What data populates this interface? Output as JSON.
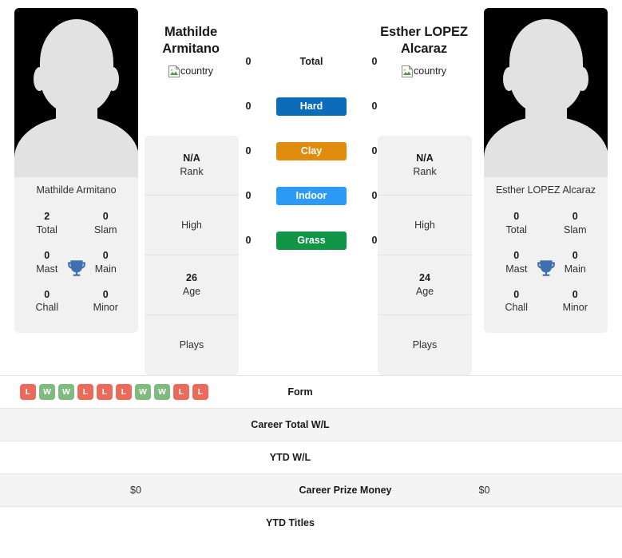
{
  "players": [
    {
      "full_name_line1": "Mathilde",
      "full_name_line2": "Armitano",
      "card_name": "Mathilde Armitano",
      "flag_alt": "country",
      "titles": {
        "total": "2",
        "total_label": "Total",
        "slam": "0",
        "slam_label": "Slam",
        "mast": "0",
        "mast_label": "Mast",
        "main": "0",
        "main_label": "Main",
        "chall": "0",
        "chall_label": "Chall",
        "minor": "0",
        "minor_label": "Minor"
      },
      "info": [
        {
          "value": "N/A",
          "label": "Rank"
        },
        {
          "value": "",
          "label": "High"
        },
        {
          "value": "26",
          "label": "Age"
        },
        {
          "value": "",
          "label": "Plays"
        }
      ],
      "surface_scores": {
        "total": "0",
        "hard": "0",
        "clay": "0",
        "indoor": "0",
        "grass": "0"
      },
      "form": [
        "L",
        "W",
        "W",
        "L",
        "L",
        "L",
        "W",
        "W",
        "L",
        "L"
      ],
      "career_total_wl": "",
      "ytd_wl": "",
      "career_prize_money": "$0",
      "ytd_titles": ""
    },
    {
      "full_name_line1": "Esther LOPEZ",
      "full_name_line2": "Alcaraz",
      "card_name": "Esther LOPEZ Alcaraz",
      "flag_alt": "country",
      "titles": {
        "total": "0",
        "total_label": "Total",
        "slam": "0",
        "slam_label": "Slam",
        "mast": "0",
        "mast_label": "Mast",
        "main": "0",
        "main_label": "Main",
        "chall": "0",
        "chall_label": "Chall",
        "minor": "0",
        "minor_label": "Minor"
      },
      "info": [
        {
          "value": "N/A",
          "label": "Rank"
        },
        {
          "value": "",
          "label": "High"
        },
        {
          "value": "24",
          "label": "Age"
        },
        {
          "value": "",
          "label": "Plays"
        }
      ],
      "surface_scores": {
        "total": "0",
        "hard": "0",
        "clay": "0",
        "indoor": "0",
        "grass": "0"
      },
      "form": [],
      "career_total_wl": "",
      "ytd_wl": "",
      "career_prize_money": "$0",
      "ytd_titles": ""
    }
  ],
  "surfaces": {
    "total_label": "Total",
    "hard_label": "Hard",
    "clay_label": "Clay",
    "indoor_label": "Indoor",
    "grass_label": "Grass"
  },
  "colors": {
    "hard": "#0c6cb9",
    "clay": "#e08c0e",
    "indoor": "#2c9bf5",
    "grass": "#119546",
    "win": "#7fba7f",
    "loss": "#ec6a5c",
    "trophy": "#3f6fad",
    "card_bg": "#f1f1f1",
    "row_alt_bg": "#f4f4f4"
  },
  "stats_rows": {
    "form": "Form",
    "career_total_wl": "Career Total W/L",
    "ytd_wl": "YTD W/L",
    "career_prize_money": "Career Prize Money",
    "ytd_titles": "YTD Titles"
  }
}
